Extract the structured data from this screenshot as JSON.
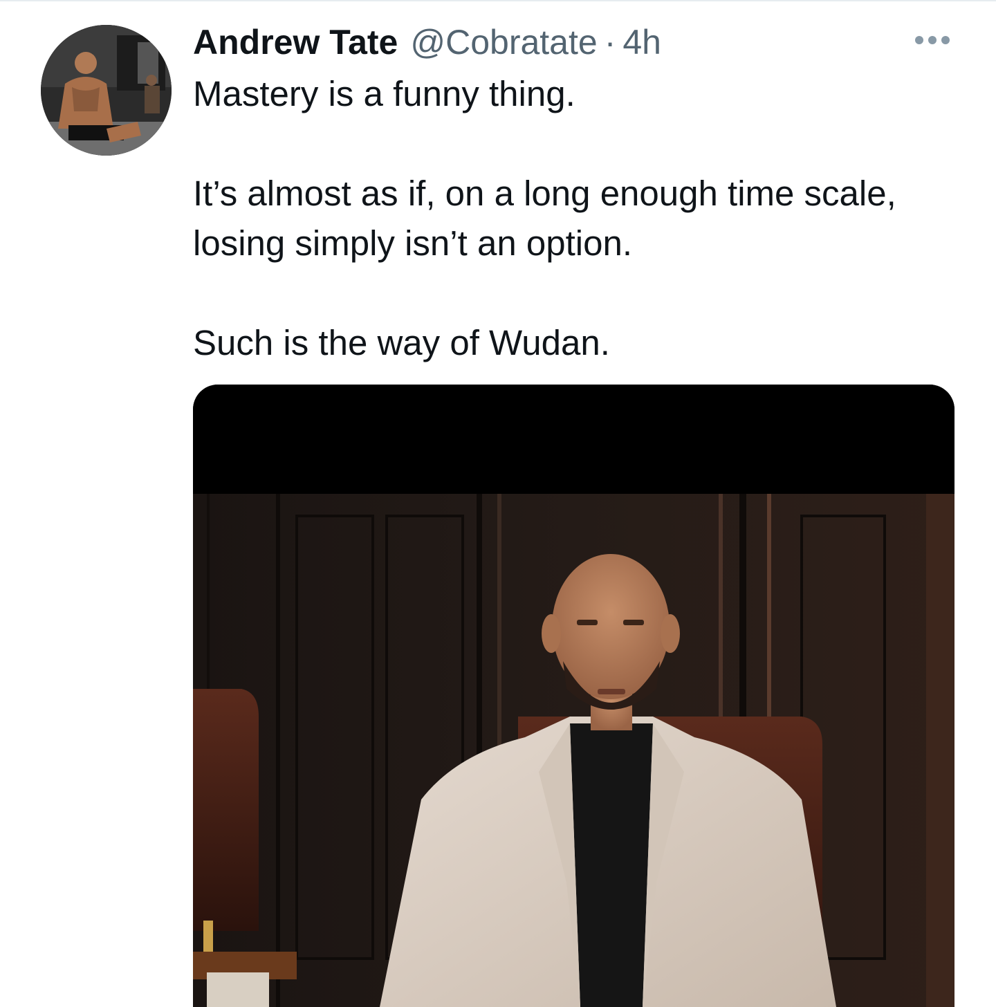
{
  "tweet": {
    "display_name": "Andrew Tate",
    "handle": "@Cobratate",
    "separator": "·",
    "timestamp": "4h",
    "text_lines": [
      "Mastery is a funny thing.",
      "It’s almost as if, on a long enough time scale, losing simply isn’t an option.",
      "Such is the way of Wudan."
    ],
    "avatar_icon": "avatar-photo",
    "more_icon": "more-horizontal-icon",
    "media_icon": "photo-man-in-leather-chair"
  },
  "colors": {
    "primary_text": "#0f1419",
    "secondary_text": "#536471",
    "divider": "#e6ecf0",
    "more_dots": "#8899a6"
  }
}
